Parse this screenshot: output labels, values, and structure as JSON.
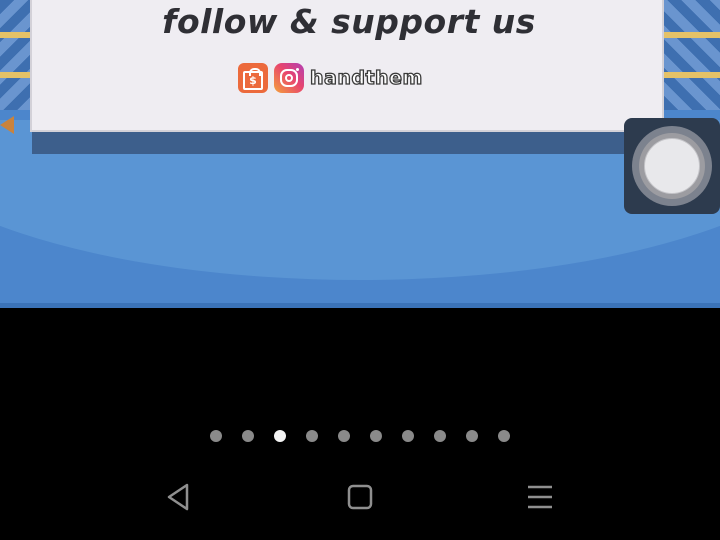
{
  "media": {
    "headline": "follow & support us",
    "social_handle": "handthem",
    "icons": [
      "shopping-bag-icon",
      "instagram-icon"
    ],
    "colors": {
      "background_blue": "#4c86cc",
      "card": "#efedf2",
      "headline_text": "#2f2f35",
      "shop_icon": "#ec6a3c"
    }
  },
  "assistive_touch": {
    "icon": "assistive-touch-icon"
  },
  "page_indicator": {
    "count": 10,
    "active_index": 2
  },
  "navigation_bar": {
    "buttons": [
      "back-icon",
      "home-icon",
      "menu-icon"
    ],
    "color": "#8f8f8f"
  }
}
